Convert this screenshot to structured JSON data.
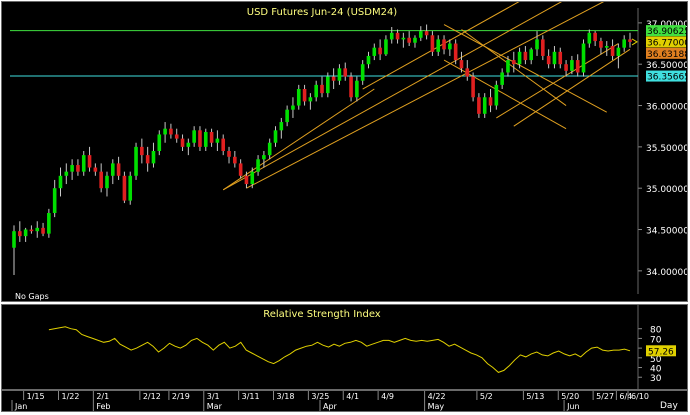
{
  "colors": {
    "background": "#000000",
    "up_candle": "#00e000",
    "down_candle": "#e02020",
    "wick": "#c8c8c8",
    "trend_line": "#e0a020",
    "hline_green": "#40e040",
    "hline_cyan": "#40e0e0",
    "rsi_line": "#e0d000",
    "text": "#ffff80",
    "axis_text": "#ffffff"
  },
  "footer": {
    "period_label": "Day"
  },
  "chart_data": [
    {
      "type": "candlestick",
      "title": "USD  Futures  Jun-24  (USDM24)",
      "note": "No  Gaps",
      "ylim": [
        33.72,
        37.18
      ],
      "y_ticks": [
        "37.00000",
        "36.50000",
        "36.00000",
        "35.50000",
        "35.00000",
        "34.50000",
        "34.00000"
      ],
      "y_tick_values": [
        37.0,
        36.5,
        36.0,
        35.5,
        35.0,
        34.5,
        34.0
      ],
      "x_ticks_top": [
        "1/15",
        "1/22",
        "2/1",
        "2/12",
        "2/19",
        "3/1",
        "3/11",
        "3/18",
        "3/25",
        "4/1",
        "4/9",
        "4/22",
        "5/2",
        "5/13",
        "5/20",
        "5/27",
        "6/4",
        "6/10"
      ],
      "x_ticks_bottom": [
        "Jan",
        "Feb",
        "Mar",
        "Apr",
        "May",
        "Jun"
      ],
      "price_labels": [
        {
          "text": "36.90625",
          "value": 36.90625,
          "color": "#40e040"
        },
        {
          "text": "36.77000",
          "value": 36.77,
          "color": "#e0d000"
        },
        {
          "text": "36.63188",
          "value": 36.63188,
          "color": "#e08020"
        },
        {
          "text": "36.35665",
          "value": 36.35665,
          "color": "#40e0e0"
        }
      ],
      "horizontal_lines": [
        {
          "value": 36.90625,
          "color": "#40e040"
        },
        {
          "value": 36.35665,
          "color": "#40e0e0"
        }
      ],
      "candles": [
        [
          34.28,
          34.55,
          33.95,
          34.48
        ],
        [
          34.48,
          34.6,
          34.35,
          34.42
        ],
        [
          34.42,
          34.52,
          34.35,
          34.5
        ],
        [
          34.5,
          34.55,
          34.45,
          34.48
        ],
        [
          34.48,
          34.6,
          34.4,
          34.52
        ],
        [
          34.52,
          34.58,
          34.42,
          34.45
        ],
        [
          34.45,
          34.75,
          34.4,
          34.7
        ],
        [
          34.7,
          35.1,
          34.65,
          35.0
        ],
        [
          35.0,
          35.25,
          34.9,
          35.15
        ],
        [
          35.15,
          35.3,
          35.05,
          35.2
        ],
        [
          35.2,
          35.35,
          35.1,
          35.28
        ],
        [
          35.28,
          35.35,
          35.15,
          35.2
        ],
        [
          35.2,
          35.45,
          35.15,
          35.4
        ],
        [
          35.4,
          35.5,
          35.2,
          35.25
        ],
        [
          35.25,
          35.3,
          35.15,
          35.2
        ],
        [
          35.2,
          35.3,
          34.95,
          35.0
        ],
        [
          35.0,
          35.2,
          34.9,
          35.15
        ],
        [
          35.15,
          35.35,
          35.05,
          35.3
        ],
        [
          35.3,
          35.38,
          35.1,
          35.15
        ],
        [
          35.15,
          35.2,
          34.82,
          34.85
        ],
        [
          34.85,
          35.2,
          34.8,
          35.15
        ],
        [
          35.15,
          35.55,
          35.1,
          35.5
        ],
        [
          35.5,
          35.6,
          35.3,
          35.4
        ],
        [
          35.4,
          35.5,
          35.2,
          35.3
        ],
        [
          35.3,
          35.55,
          35.25,
          35.45
        ],
        [
          35.45,
          35.7,
          35.4,
          35.65
        ],
        [
          35.65,
          35.8,
          35.55,
          35.72
        ],
        [
          35.72,
          35.78,
          35.6,
          35.65
        ],
        [
          35.65,
          35.72,
          35.55,
          35.6
        ],
        [
          35.6,
          35.65,
          35.45,
          35.5
        ],
        [
          35.5,
          35.6,
          35.4,
          35.55
        ],
        [
          35.55,
          35.75,
          35.5,
          35.7
        ],
        [
          35.7,
          35.75,
          35.45,
          35.5
        ],
        [
          35.5,
          35.72,
          35.45,
          35.68
        ],
        [
          35.68,
          35.72,
          35.5,
          35.55
        ],
        [
          35.55,
          35.7,
          35.45,
          35.6
        ],
        [
          35.6,
          35.65,
          35.4,
          35.45
        ],
        [
          35.45,
          35.5,
          35.3,
          35.38
        ],
        [
          35.38,
          35.45,
          35.25,
          35.3
        ],
        [
          35.3,
          35.35,
          35.12,
          35.15
        ],
        [
          35.15,
          35.2,
          35.0,
          35.05
        ],
        [
          35.05,
          35.25,
          35.0,
          35.2
        ],
        [
          35.2,
          35.4,
          35.15,
          35.35
        ],
        [
          35.35,
          35.45,
          35.25,
          35.4
        ],
        [
          35.4,
          35.6,
          35.35,
          35.55
        ],
        [
          35.55,
          35.75,
          35.5,
          35.7
        ],
        [
          35.7,
          35.85,
          35.6,
          35.8
        ],
        [
          35.8,
          36.0,
          35.75,
          35.95
        ],
        [
          35.95,
          36.1,
          35.85,
          36.0
        ],
        [
          36.0,
          36.25,
          35.95,
          36.2
        ],
        [
          36.2,
          36.25,
          36.0,
          36.05
        ],
        [
          36.05,
          36.15,
          35.95,
          36.1
        ],
        [
          36.1,
          36.3,
          36.05,
          36.25
        ],
        [
          36.25,
          36.35,
          36.1,
          36.15
        ],
        [
          36.15,
          36.4,
          36.1,
          36.35
        ],
        [
          36.35,
          36.45,
          36.2,
          36.3
        ],
        [
          36.3,
          36.5,
          36.25,
          36.45
        ],
        [
          36.45,
          36.52,
          36.3,
          36.35
        ],
        [
          36.35,
          36.4,
          36.05,
          36.1
        ],
        [
          36.1,
          36.35,
          36.05,
          36.3
        ],
        [
          36.3,
          36.55,
          36.25,
          36.5
        ],
        [
          36.5,
          36.65,
          36.45,
          36.6
        ],
        [
          36.6,
          36.75,
          36.55,
          36.7
        ],
        [
          36.7,
          36.8,
          36.55,
          36.62
        ],
        [
          36.62,
          36.85,
          36.6,
          36.8
        ],
        [
          36.8,
          36.95,
          36.75,
          36.88
        ],
        [
          36.88,
          36.92,
          36.75,
          36.8
        ],
        [
          36.8,
          36.88,
          36.7,
          36.82
        ],
        [
          36.82,
          36.9,
          36.72,
          36.76
        ],
        [
          36.76,
          36.85,
          36.7,
          36.82
        ],
        [
          36.82,
          36.96,
          36.78,
          36.9
        ],
        [
          36.9,
          36.98,
          36.8,
          36.85
        ],
        [
          36.85,
          36.9,
          36.6,
          36.65
        ],
        [
          36.65,
          36.85,
          36.6,
          36.8
        ],
        [
          36.8,
          36.85,
          36.62,
          36.68
        ],
        [
          36.68,
          36.8,
          36.6,
          36.75
        ],
        [
          36.75,
          36.8,
          36.5,
          36.55
        ],
        [
          36.55,
          36.65,
          36.4,
          36.45
        ],
        [
          36.45,
          36.55,
          36.3,
          36.35
        ],
        [
          36.35,
          36.4,
          36.05,
          36.1
        ],
        [
          36.1,
          36.15,
          35.85,
          35.9
        ],
        [
          35.9,
          36.15,
          35.85,
          36.1
        ],
        [
          36.1,
          36.2,
          35.92,
          36.0
        ],
        [
          36.0,
          36.3,
          35.95,
          36.25
        ],
        [
          36.25,
          36.45,
          36.2,
          36.4
        ],
        [
          36.4,
          36.6,
          36.35,
          36.55
        ],
        [
          36.55,
          36.65,
          36.4,
          36.5
        ],
        [
          36.5,
          36.7,
          36.45,
          36.65
        ],
        [
          36.65,
          36.72,
          36.5,
          36.55
        ],
        [
          36.55,
          36.7,
          36.5,
          36.68
        ],
        [
          36.68,
          36.9,
          36.6,
          36.8
        ],
        [
          36.8,
          36.85,
          36.55,
          36.6
        ],
        [
          36.6,
          36.68,
          36.45,
          36.5
        ],
        [
          36.5,
          36.72,
          36.45,
          36.65
        ],
        [
          36.65,
          36.7,
          36.45,
          36.5
        ],
        [
          36.5,
          36.55,
          36.35,
          36.42
        ],
        [
          36.42,
          36.6,
          36.38,
          36.55
        ],
        [
          36.55,
          36.62,
          36.35,
          36.4
        ],
        [
          36.4,
          36.8,
          36.35,
          36.75
        ],
        [
          36.75,
          36.92,
          36.7,
          36.88
        ],
        [
          36.88,
          36.9,
          36.72,
          36.78
        ],
        [
          36.78,
          36.82,
          36.62,
          36.7
        ],
        [
          36.7,
          36.78,
          36.6,
          36.72
        ],
        [
          36.72,
          36.8,
          36.55,
          36.6
        ],
        [
          36.6,
          36.75,
          36.45,
          36.7
        ],
        [
          36.7,
          36.85,
          36.65,
          36.8
        ],
        [
          36.8,
          36.88,
          36.7,
          36.77
        ]
      ]
    },
    {
      "type": "line",
      "title": "Relative  Strength  Index",
      "ylim": [
        22,
        90
      ],
      "y_ticks": [
        "80",
        "70",
        "60",
        "50",
        "40",
        "30"
      ],
      "y_tick_values": [
        80,
        70,
        60,
        50,
        40,
        30
      ],
      "last_value_label": "57.26",
      "last_value": 57.26,
      "values": [
        79,
        80,
        81,
        82,
        80,
        79,
        74,
        72,
        70,
        68,
        66,
        67,
        70,
        64,
        61,
        58,
        60,
        63,
        66,
        62,
        56,
        60,
        65,
        62,
        60,
        63,
        68,
        70,
        66,
        63,
        58,
        63,
        66,
        60,
        62,
        66,
        58,
        55,
        52,
        49,
        46,
        44,
        47,
        51,
        54,
        58,
        60,
        62,
        63,
        66,
        63,
        61,
        64,
        62,
        65,
        66,
        68,
        66,
        62,
        64,
        66,
        68,
        68,
        66,
        68,
        70,
        68,
        67,
        68,
        67,
        68,
        69,
        66,
        62,
        64,
        61,
        58,
        55,
        53,
        50,
        44,
        40,
        35,
        37,
        42,
        48,
        53,
        51,
        54,
        56,
        53,
        52,
        55,
        57,
        54,
        52,
        54,
        51,
        56,
        60,
        61,
        58,
        57,
        58,
        58,
        59,
        57.26
      ]
    }
  ]
}
